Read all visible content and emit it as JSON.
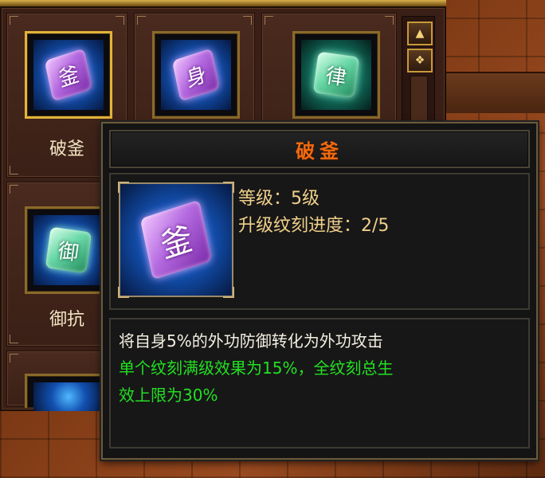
{
  "skills": [
    {
      "name": "破釜",
      "glyph": "釜",
      "gem": "blue",
      "selected": true
    },
    {
      "name": "",
      "glyph": "身",
      "gem": "blue",
      "selected": false
    },
    {
      "name": "",
      "glyph": "律",
      "gem": "green",
      "selected": false
    },
    {
      "name": "御抗",
      "glyph": "御",
      "gem": "green",
      "selected": false
    }
  ],
  "scroll": {
    "up_icon": "arrow-up-icon",
    "settings_icon": "gear-icon"
  },
  "tooltip": {
    "title": "破釜",
    "icon_glyph": "釜",
    "level_line": "等级：5级",
    "progress_line": "升级纹刻进度：2/5",
    "description": "将自身5%的外功防御转化为外功攻击",
    "bonus_line_1": "单个纹刻满级效果为15%，全纹刻总生",
    "bonus_line_2": "效上限为30%"
  },
  "colors": {
    "title": "#ef6a10",
    "stats": "#f0d08a",
    "desc": "#f4efe2",
    "bonus": "#22e022"
  }
}
